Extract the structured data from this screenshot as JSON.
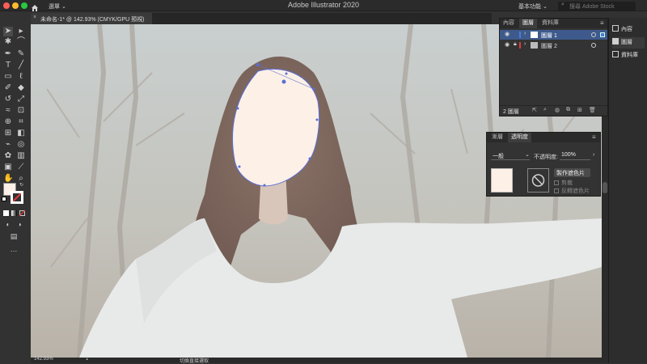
{
  "app": {
    "title": "Adobe Illustrator 2020",
    "menu_label": "選單",
    "workspace": "基本功能",
    "search_placeholder": "搜尋 Adobe Stock"
  },
  "document_tab": {
    "label": "未命名-1* @ 142.93% (CMYK/GPU 預視)",
    "close": "×"
  },
  "status": {
    "zoom": "142.93%",
    "page": "1",
    "tool_name": "切換直接選取"
  },
  "layers_panel": {
    "tabs": [
      "內容",
      "圖層",
      "資料庫"
    ],
    "active_tab": 1,
    "layers": [
      {
        "name": "圖層 1",
        "visible": true,
        "locked": false,
        "color": "#4a7bd4",
        "selected": true
      },
      {
        "name": "圖層 2",
        "visible": true,
        "locked": true,
        "color": "#e03a3a",
        "selected": false
      }
    ],
    "footer_count": "2 圖層"
  },
  "transparency_panel": {
    "tabs": [
      "漸層",
      "透明度"
    ],
    "active_tab": 1,
    "blend_mode": "一般",
    "opacity_label": "不透明度:",
    "opacity_value": "100%",
    "make_mask_label": "製作遮色片",
    "clip_label": "剪裁",
    "invert_label": "反轉遮色片"
  },
  "right_dock": {
    "items": [
      "內容",
      "圖層",
      "資料庫"
    ]
  },
  "colors": {
    "accent": "#4a7bd4",
    "face_fill": "#fdf0e6",
    "path": "#5b6fd6"
  }
}
